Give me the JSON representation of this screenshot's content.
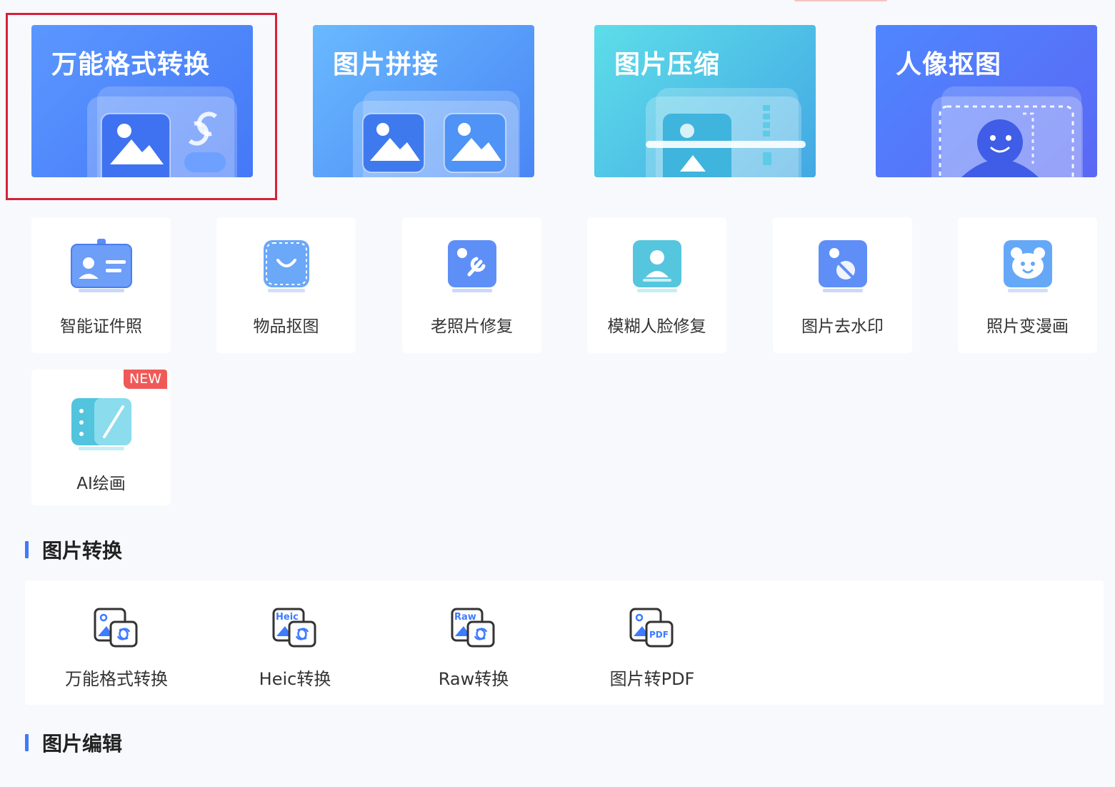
{
  "feature_cards": [
    {
      "title": "万能格式转换",
      "icon": "format-convert-illustration"
    },
    {
      "title": "图片拼接",
      "icon": "image-stitch-illustration"
    },
    {
      "title": "图片压缩",
      "icon": "image-compress-illustration"
    },
    {
      "title": "人像抠图",
      "icon": "portrait-cutout-illustration"
    }
  ],
  "tools": [
    {
      "label": "智能证件照",
      "icon": "id-photo-icon"
    },
    {
      "label": "物品抠图",
      "icon": "object-cutout-icon"
    },
    {
      "label": "老照片修复",
      "icon": "old-photo-repair-icon"
    },
    {
      "label": "模糊人脸修复",
      "icon": "blurry-face-repair-icon"
    },
    {
      "label": "图片去水印",
      "icon": "watermark-remove-icon"
    },
    {
      "label": "照片变漫画",
      "icon": "photo-to-cartoon-icon"
    },
    {
      "label": "AI绘画",
      "icon": "ai-painting-icon",
      "badge": "NEW"
    }
  ],
  "sections": [
    {
      "title": "图片转换",
      "items": [
        {
          "label": "万能格式转换",
          "icon": "universal-convert-icon"
        },
        {
          "label": "Heic转换",
          "icon": "heic-convert-icon",
          "tag": "Heic"
        },
        {
          "label": "Raw转换",
          "icon": "raw-convert-icon",
          "tag": "Raw"
        },
        {
          "label": "图片转PDF",
          "icon": "image-to-pdf-icon",
          "tag": "PDF"
        }
      ]
    },
    {
      "title": "图片编辑",
      "items": []
    }
  ],
  "colors": {
    "accent": "#3d7bff",
    "selection_border": "#d7213a",
    "badge": "#ef5a58",
    "page_background": "#f8f9fc"
  }
}
